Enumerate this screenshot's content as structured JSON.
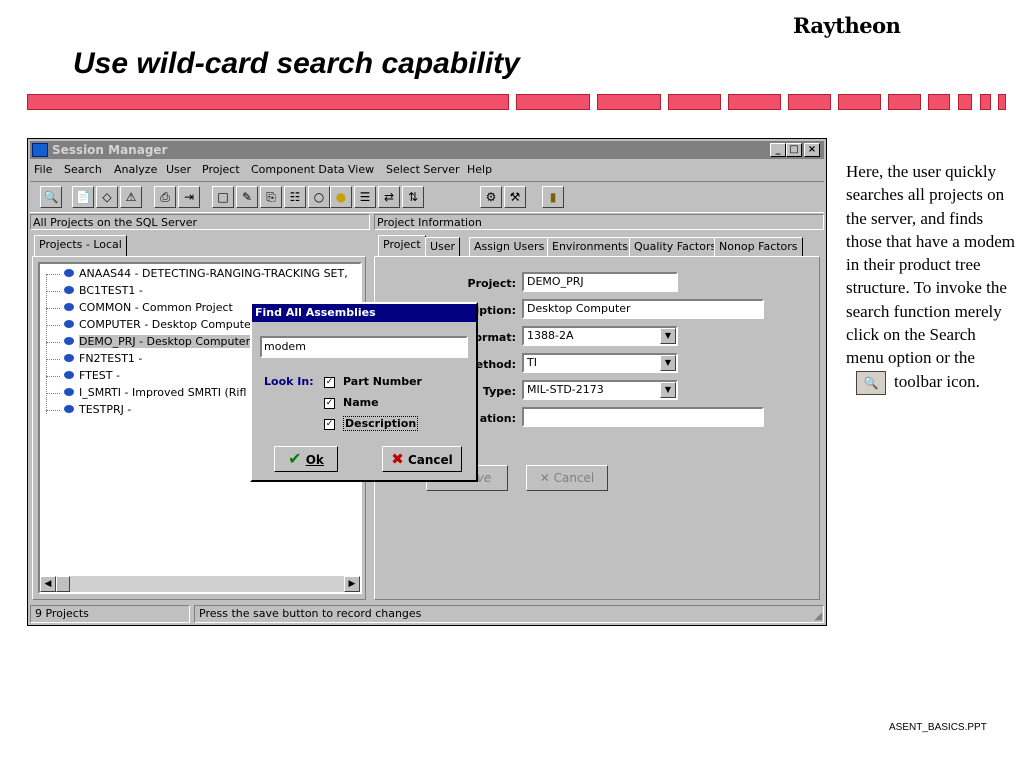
{
  "slide": {
    "logo": "Raytheon",
    "title": "Use wild-card search capability",
    "note": "Here, the user quickly searches all projects on the server, and finds those that have a modem in their product tree structure. To invoke the search function merely click on the Search menu option or the",
    "note_tail": "toolbar icon.",
    "footer": "ASENT_BASICS.PPT",
    "accent_color": "#f0506a"
  },
  "window": {
    "title": "Session Manager",
    "controls": [
      "_",
      "□",
      "×"
    ],
    "menu": [
      "File",
      "Search",
      "Analyze",
      "User",
      "Project",
      "Component Data",
      "View",
      "Select Server",
      "Help"
    ],
    "toolbar_icons": [
      "binoculars-icon",
      "document-icon",
      "eraser-icon",
      "warning-icon",
      "printer-icon",
      "export-icon",
      "new-document-icon",
      "pencil-icon",
      "copy-icon",
      "tree-icon",
      "bulb-off-icon",
      "bulb-on-icon",
      "report-icon",
      "transfer-icon",
      "sort-icon",
      "gear-icon",
      "tools-icon",
      "exit-icon"
    ]
  },
  "left_pane": {
    "header": "All Projects on the SQL Server",
    "tab": "Projects - Local",
    "tree": [
      "ANAAS44 - DETECTING-RANGING-TRACKING SET,",
      "BC1TEST1 -",
      "COMMON - Common Project",
      "COMPUTER - Desktop Compute",
      "DEMO_PRJ - Desktop Computer",
      "FN2TEST1 -",
      "FTEST -",
      "I_SMRTI - Improved SMRTI (Rifl",
      "TESTPRJ -"
    ],
    "selected_index": 4
  },
  "right_pane": {
    "header": "Project Information",
    "tabs": [
      "Project",
      "User",
      "Assign Users",
      "Environments",
      "Quality Factors",
      "Nonop Factors"
    ],
    "fields": {
      "project_label": "Project:",
      "project_value": "DEMO_PRJ",
      "description_label": "iption:",
      "description_value": "Desktop Computer",
      "format_label": "ormat:",
      "format_value": "1388-2A",
      "method_label": "ethod:",
      "method_value": "TI",
      "type_label": "Type:",
      "type_value": "MIL-STD-2173",
      "location_label": "ation:",
      "location_value": ""
    },
    "save_label": "ve",
    "cancel_label": "Cancel"
  },
  "dialog": {
    "title": "Find All Assemblies",
    "search_value": "modem",
    "look_in_label": "Look In:",
    "options": [
      {
        "label": "Part Number",
        "checked": true
      },
      {
        "label": "Name",
        "checked": true
      },
      {
        "label": "Description",
        "checked": true
      }
    ],
    "ok_label": "Ok",
    "cancel_label": "Cancel"
  },
  "status_bar": {
    "count": "9 Projects",
    "message": "Press the save button to record changes"
  }
}
